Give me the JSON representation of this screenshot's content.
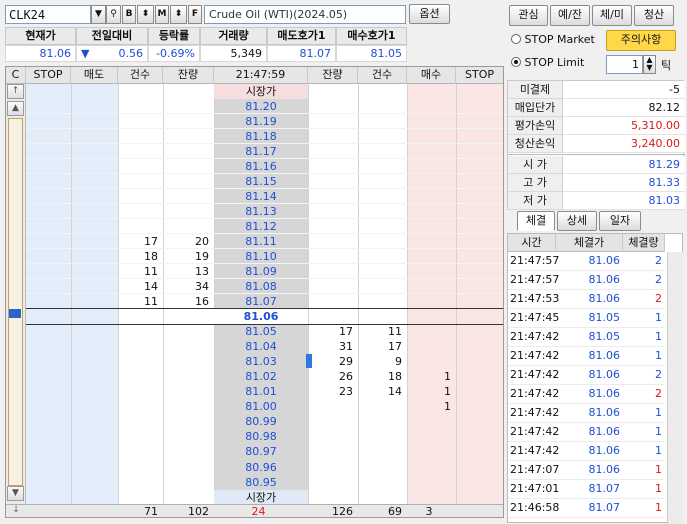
{
  "toolbar": {
    "symbol": "CLK24",
    "name": "Crude Oil (WTI)(2024.05)",
    "option_label": "옵션",
    "btn_b": "B",
    "btn_m": "M",
    "btn_f": "F"
  },
  "quote": {
    "headers": [
      "현재가",
      "전일대비",
      "등락률",
      "거래량",
      "매도호가1",
      "매수호가1"
    ],
    "current": "81.06",
    "change_arrow": "▼",
    "change": "0.56",
    "rate": "-0.69%",
    "volume": "5,349",
    "ask1": "81.07",
    "bid1": "81.05"
  },
  "orderbook": {
    "headers": [
      "C",
      "STOP",
      "매도",
      "건수",
      "잔량",
      "21:47:59",
      "잔량",
      "건수",
      "매수",
      "STOP"
    ],
    "market_label": "시장가",
    "current_price": "81.06",
    "asks": [
      {
        "price": "81.20",
        "count": "",
        "qty": ""
      },
      {
        "price": "81.19",
        "count": "",
        "qty": ""
      },
      {
        "price": "81.18",
        "count": "",
        "qty": ""
      },
      {
        "price": "81.17",
        "count": "",
        "qty": ""
      },
      {
        "price": "81.16",
        "count": "",
        "qty": ""
      },
      {
        "price": "81.15",
        "count": "",
        "qty": ""
      },
      {
        "price": "81.14",
        "count": "",
        "qty": ""
      },
      {
        "price": "81.13",
        "count": "",
        "qty": ""
      },
      {
        "price": "81.12",
        "count": "",
        "qty": ""
      },
      {
        "price": "81.11",
        "count": "17",
        "qty": "20"
      },
      {
        "price": "81.10",
        "count": "18",
        "qty": "19"
      },
      {
        "price": "81.09",
        "count": "11",
        "qty": "13"
      },
      {
        "price": "81.08",
        "count": "14",
        "qty": "34"
      },
      {
        "price": "81.07",
        "count": "11",
        "qty": "16"
      }
    ],
    "bids": [
      {
        "price": "81.05",
        "qty": "17",
        "count": "11",
        "buy": ""
      },
      {
        "price": "81.04",
        "qty": "31",
        "count": "17",
        "buy": ""
      },
      {
        "price": "81.03",
        "qty": "29",
        "count": "9",
        "buy": ""
      },
      {
        "price": "81.02",
        "qty": "26",
        "count": "18",
        "buy": "1"
      },
      {
        "price": "81.01",
        "qty": "23",
        "count": "14",
        "buy": "1"
      },
      {
        "price": "81.00",
        "qty": "",
        "count": "",
        "buy": "1"
      },
      {
        "price": "80.99",
        "qty": "",
        "count": "",
        "buy": ""
      },
      {
        "price": "80.98",
        "qty": "",
        "count": "",
        "buy": ""
      },
      {
        "price": "80.97",
        "qty": "",
        "count": "",
        "buy": ""
      },
      {
        "price": "80.96",
        "qty": "",
        "count": "",
        "buy": ""
      },
      {
        "price": "80.95",
        "qty": "",
        "count": "",
        "buy": ""
      }
    ],
    "footer": {
      "ask_count": "71",
      "ask_qty": "102",
      "diff": "24",
      "bid_qty": "126",
      "bid_count": "69",
      "buy": "3"
    }
  },
  "panel": {
    "tabs": [
      "관심",
      "예/잔",
      "체/미",
      "청산"
    ],
    "stop_market": "STOP Market",
    "stop_limit": "STOP Limit",
    "notice": "주의사항",
    "tick_value": "1",
    "tick_label": "틱",
    "balance": [
      {
        "label": "미결제",
        "value": "-5"
      },
      {
        "label": "매입단가",
        "value": "82.12"
      },
      {
        "label": "평가손익",
        "value": "5,310.00"
      },
      {
        "label": "청산손익",
        "value": "3,240.00"
      }
    ],
    "ohl": [
      {
        "label": "시 가",
        "value": "81.29"
      },
      {
        "label": "고 가",
        "value": "81.33"
      },
      {
        "label": "저 가",
        "value": "81.03"
      }
    ],
    "subtabs": [
      "체결",
      "상세",
      "일자"
    ],
    "trade_headers": [
      "시간",
      "체결가",
      "체결량"
    ],
    "trades": [
      {
        "time": "21:47:57",
        "price": "81.06",
        "qty": "2",
        "side": "buy"
      },
      {
        "time": "21:47:57",
        "price": "81.06",
        "qty": "2",
        "side": "buy"
      },
      {
        "time": "21:47:53",
        "price": "81.06",
        "qty": "2",
        "side": "sell"
      },
      {
        "time": "21:47:45",
        "price": "81.05",
        "qty": "1",
        "side": "buy"
      },
      {
        "time": "21:47:42",
        "price": "81.05",
        "qty": "1",
        "side": "buy"
      },
      {
        "time": "21:47:42",
        "price": "81.06",
        "qty": "1",
        "side": "buy"
      },
      {
        "time": "21:47:42",
        "price": "81.06",
        "qty": "2",
        "side": "buy"
      },
      {
        "time": "21:47:42",
        "price": "81.06",
        "qty": "2",
        "side": "sell"
      },
      {
        "time": "21:47:42",
        "price": "81.06",
        "qty": "1",
        "side": "buy"
      },
      {
        "time": "21:47:42",
        "price": "81.06",
        "qty": "1",
        "side": "buy"
      },
      {
        "time": "21:47:42",
        "price": "81.06",
        "qty": "1",
        "side": "buy"
      },
      {
        "time": "21:47:07",
        "price": "81.06",
        "qty": "1",
        "side": "sell"
      },
      {
        "time": "21:47:01",
        "price": "81.07",
        "qty": "1",
        "side": "sell"
      },
      {
        "time": "21:46:58",
        "price": "81.07",
        "qty": "1",
        "side": "sell"
      }
    ]
  },
  "colors": {
    "ask_bg": "#e3eefa",
    "bid_bg": "#fbe6e6",
    "price_bg": "#d6d6d6",
    "blue": "#1e4fd8",
    "red": "#d81818"
  }
}
